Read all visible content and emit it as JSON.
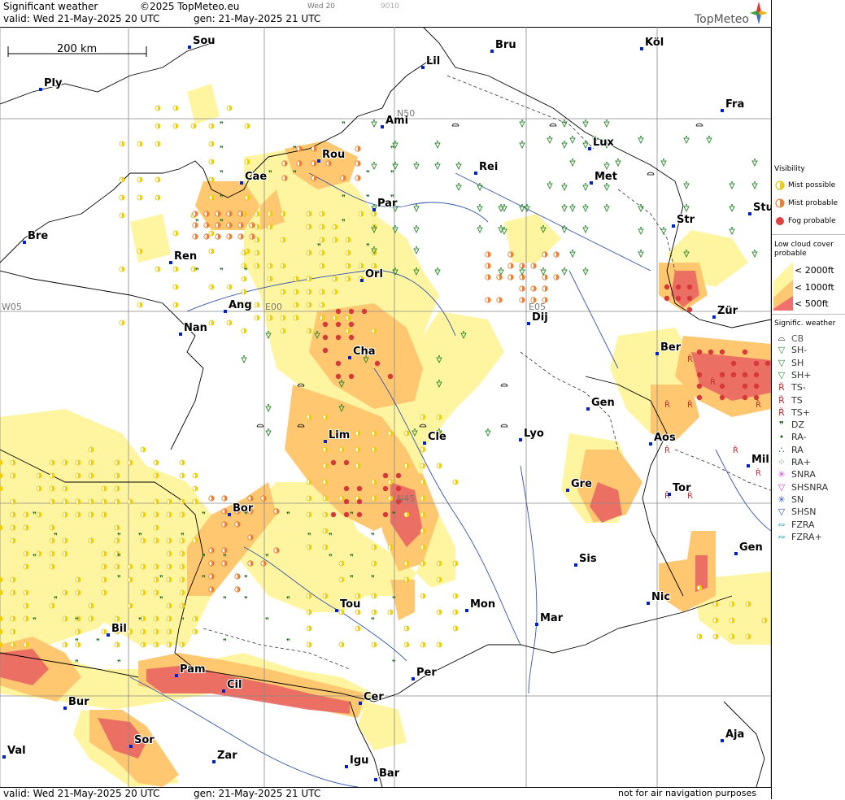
{
  "header": {
    "title": "Significant weather",
    "copyright": "©2025 TopMeteo.eu",
    "tab_day": "Wed 20",
    "tab_code": "9010",
    "valid": "valid:  Wed  21-May-2025  20 UTC",
    "gen": "gen: 21-May-2025 21 UTC",
    "logo": "TopMeteo"
  },
  "footer": {
    "valid": "valid:  Wed  21-May-2025  20 UTC",
    "gen": "gen: 21-May-2025 21 UTC",
    "note": "not for air navigation purposes"
  },
  "map": {
    "scale_label": "200 km",
    "grid_labels": [
      "N50",
      "N45",
      "W05",
      "E00",
      "E05"
    ],
    "cities": [
      "Sou",
      "Bru",
      "Köl",
      "Ply",
      "Lil",
      "Ami",
      "Fra",
      "Rou",
      "Lux",
      "Cae",
      "Rei",
      "Met",
      "Par",
      "Str",
      "Stu",
      "Bre",
      "Ren",
      "Orl",
      "Ang",
      "Nan",
      "Dij",
      "Zür",
      "Cha",
      "Ber",
      "Gen",
      "Lim",
      "Cle",
      "Lyo",
      "Aos",
      "Mil",
      "Gre",
      "Bor",
      "Tor",
      "Sis",
      "Gen",
      "Tou",
      "Mon",
      "Mar",
      "Nic",
      "Bil",
      "Pam",
      "Cil",
      "Per",
      "Bur",
      "Cer",
      "Sor",
      "Ajа",
      "Val",
      "Zar",
      "Igu",
      "Bar"
    ],
    "colors": {
      "mist": "#fff5a0",
      "probable": "#ffc870",
      "fog": "#e86060",
      "grid": "#888888",
      "border": "#000000",
      "river": "#3355aa"
    }
  },
  "legend": {
    "visibility_title": "Visibility",
    "mist_possible": "Mist possible",
    "mist_probable": "Mist probable",
    "fog_probable": "Fog probable",
    "low_cloud_title_1": "Low cloud cover",
    "low_cloud_title_2": "probable",
    "lc_2000": "< 2000ft",
    "lc_1000": "< 1000ft",
    "lc_500": "<  500ft",
    "sigwx_title": "Signific. weather",
    "items": [
      "CB",
      "SH-",
      "SH",
      "SH+",
      "TS-",
      "TS",
      "TS+",
      "DZ",
      "RA-",
      "RA",
      "RA+",
      "SNRA",
      "SHSNRA",
      "SN",
      "SHSN",
      "FZRA",
      "FZRA+"
    ],
    "item_icons": [
      "cb-icon",
      "shower-light-icon",
      "shower-icon",
      "shower-heavy-icon",
      "thunder-light-icon",
      "thunder-icon",
      "thunder-heavy-icon",
      "drizzle-icon",
      "rain-light-icon",
      "rain-icon",
      "rain-heavy-icon",
      "snow-rain-icon",
      "snow-rain-shower-icon",
      "snow-icon",
      "snow-shower-icon",
      "freezing-rain-icon",
      "freezing-rain-heavy-icon"
    ]
  }
}
